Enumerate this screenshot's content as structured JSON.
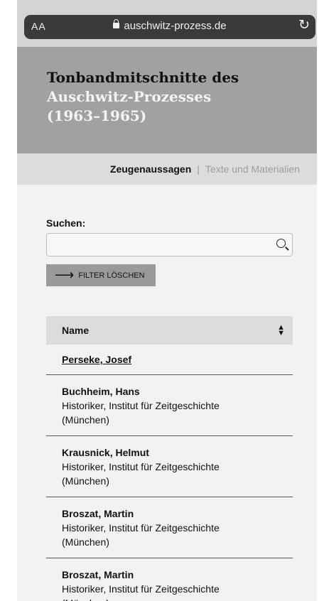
{
  "browser": {
    "aa_label": "AA",
    "url": "auschwitz-prozess.de"
  },
  "header": {
    "title_line1": "Tonbandmitschnitte des",
    "title_rest": "Auschwitz-Prozesses (1963–1965)"
  },
  "nav": {
    "active": "Zeugenaussagen",
    "separator": "|",
    "other": "Texte und Materialien"
  },
  "search": {
    "label": "Suchen:",
    "value": "",
    "placeholder": ""
  },
  "filter": {
    "label": "FILTER LÖSCHEN",
    "arrow": "⟶"
  },
  "table": {
    "column": "Name",
    "rows": [
      {
        "name": "Perseke, Josef",
        "role": ""
      },
      {
        "name": "Buchheim, Hans",
        "role": "Historiker, Institut für Zeitgeschichte (München)"
      },
      {
        "name": "Krausnick, Helmut",
        "role": "Historiker, Institut für Zeitgeschichte (München)"
      },
      {
        "name": "Broszat, Martin",
        "role": "Historiker, Institut für Zeitgeschichte (München)"
      },
      {
        "name": "Broszat, Martin",
        "role": "Historiker, Institut für Zeitgeschichte (München)"
      }
    ]
  },
  "icons": [
    "lock-icon",
    "reload-icon",
    "search-icon",
    "arrow-right-icon",
    "sort-icon"
  ]
}
